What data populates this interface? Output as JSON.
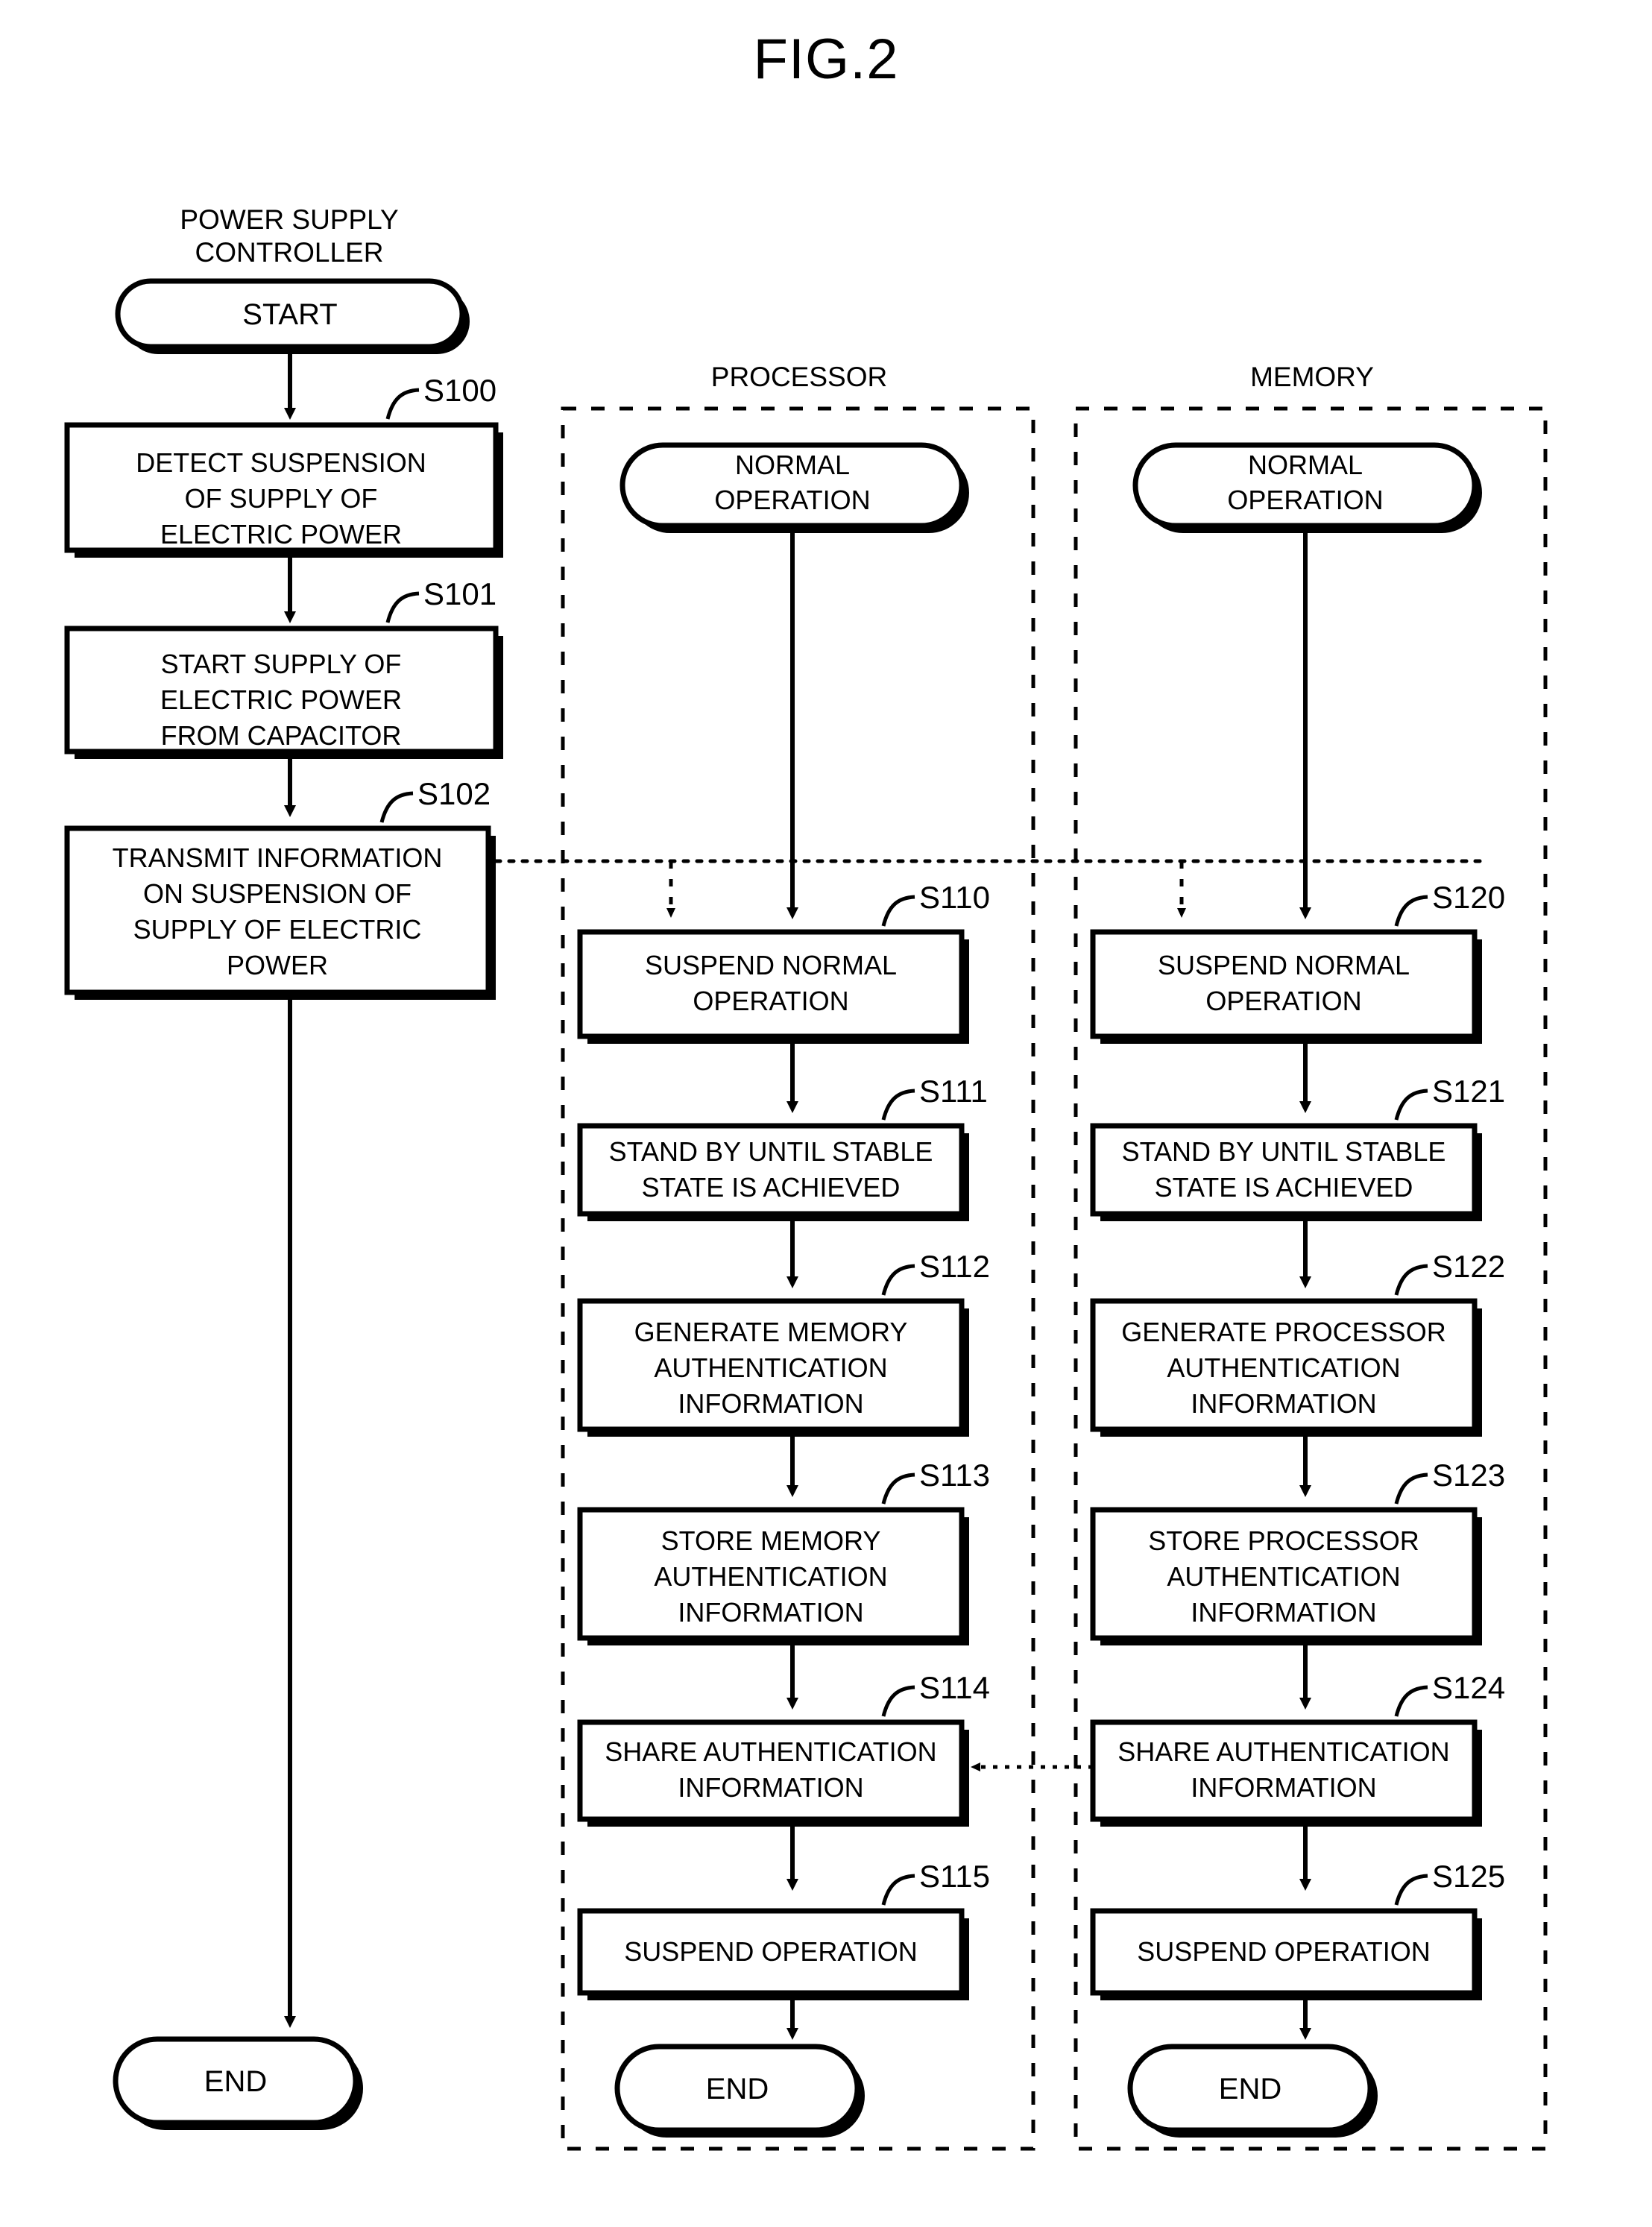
{
  "figure": {
    "title": "FIG.2",
    "type": "patent-flowchart",
    "lanes": [
      {
        "id": "power-supply-controller",
        "label": "POWER SUPPLY CONTROLLER",
        "boxed": false
      },
      {
        "id": "processor",
        "label": "PROCESSOR",
        "boxed": true
      },
      {
        "id": "memory",
        "label": "MEMORY",
        "boxed": true
      }
    ]
  },
  "power_supply_controller": {
    "header_line1": "POWER SUPPLY",
    "header_line2": "CONTROLLER",
    "start": "START",
    "end": "END",
    "steps": [
      {
        "id": "S100",
        "lines": [
          "DETECT SUSPENSION",
          "OF SUPPLY OF",
          "ELECTRIC POWER"
        ]
      },
      {
        "id": "S101",
        "lines": [
          "START SUPPLY OF",
          "ELECTRIC POWER",
          "FROM CAPACITOR"
        ]
      },
      {
        "id": "S102",
        "lines": [
          "TRANSMIT INFORMATION",
          "ON SUSPENSION OF",
          "SUPPLY OF ELECTRIC",
          "POWER"
        ]
      }
    ]
  },
  "processor": {
    "header": "PROCESSOR",
    "start_line1": "NORMAL",
    "start_line2": "OPERATION",
    "end": "END",
    "steps": [
      {
        "id": "S110",
        "lines": [
          "SUSPEND NORMAL",
          "OPERATION"
        ]
      },
      {
        "id": "S111",
        "lines": [
          "STAND BY UNTIL STABLE",
          "STATE IS ACHIEVED"
        ]
      },
      {
        "id": "S112",
        "lines": [
          "GENERATE MEMORY",
          "AUTHENTICATION",
          "INFORMATION"
        ]
      },
      {
        "id": "S113",
        "lines": [
          "STORE MEMORY",
          "AUTHENTICATION",
          "INFORMATION"
        ]
      },
      {
        "id": "S114",
        "lines": [
          "SHARE AUTHENTICATION",
          "INFORMATION"
        ]
      },
      {
        "id": "S115",
        "lines": [
          "SUSPEND OPERATION"
        ]
      }
    ]
  },
  "memory": {
    "header": "MEMORY",
    "start_line1": "NORMAL",
    "start_line2": "OPERATION",
    "end": "END",
    "steps": [
      {
        "id": "S120",
        "lines": [
          "SUSPEND NORMAL",
          "OPERATION"
        ]
      },
      {
        "id": "S121",
        "lines": [
          "STAND BY UNTIL STABLE",
          "STATE IS ACHIEVED"
        ]
      },
      {
        "id": "S122",
        "lines": [
          "GENERATE PROCESSOR",
          "AUTHENTICATION",
          "INFORMATION"
        ]
      },
      {
        "id": "S123",
        "lines": [
          "STORE PROCESSOR",
          "AUTHENTICATION",
          "INFORMATION"
        ]
      },
      {
        "id": "S124",
        "lines": [
          "SHARE AUTHENTICATION",
          "INFORMATION"
        ]
      },
      {
        "id": "S125",
        "lines": [
          "SUSPEND OPERATION"
        ]
      }
    ]
  },
  "colors": {
    "ink": "#000000",
    "paper": "#ffffff"
  }
}
